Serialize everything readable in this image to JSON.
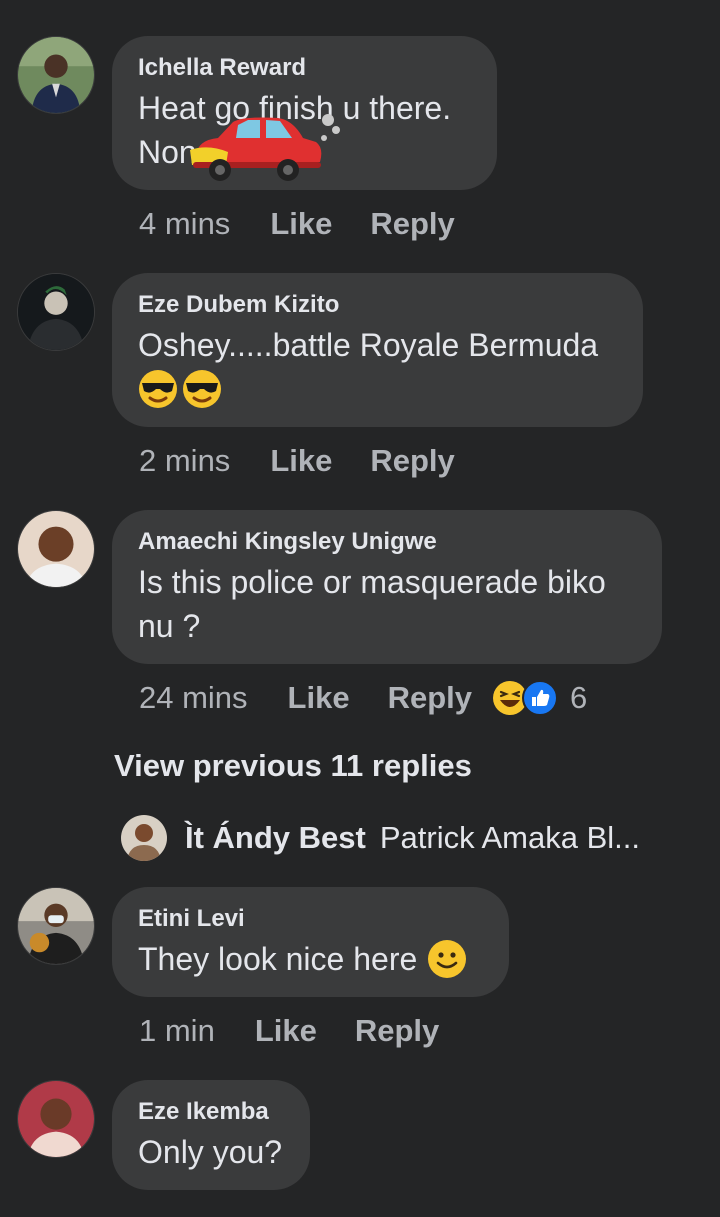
{
  "comments": [
    {
      "author": "Ichella Reward",
      "text_line1": "Heat go finish u there.",
      "text_line2": "Non",
      "time": "4 mins",
      "like": "Like",
      "reply": "Reply",
      "sticker": "car-sticker"
    },
    {
      "author": "Eze Dubem Kizito",
      "text": "Oshey.....battle Royale Bermuda",
      "emojis": [
        "sunglasses-emoji",
        "sunglasses-emoji"
      ],
      "time": "2 mins",
      "like": "Like",
      "reply": "Reply"
    },
    {
      "author": "Amaechi Kingsley Unigwe",
      "text_line1": "Is this police or masquerade biko",
      "text_line2": "nu ?",
      "time": "24 mins",
      "like": "Like",
      "reply": "Reply",
      "reactions": [
        "laugh-reaction-icon",
        "like-reaction-icon"
      ],
      "reaction_count": "6"
    },
    {
      "author": "Etini Levi",
      "text": "They look nice here",
      "emoji": "smile-emoji",
      "time": "1 min",
      "like": "Like",
      "reply": "Reply"
    },
    {
      "author": "Eze Ikemba",
      "text": "Only you?"
    }
  ],
  "view_previous": "View previous 11 replies",
  "reply_preview": {
    "name": "Ìt Ándy Best",
    "text": "Patrick Amaka Bl..."
  },
  "colors": {
    "background": "#242526",
    "bubble": "#3a3b3c",
    "text": "#e4e6eb",
    "muted": "#b0b3b8",
    "like_blue": "#1877f2"
  }
}
